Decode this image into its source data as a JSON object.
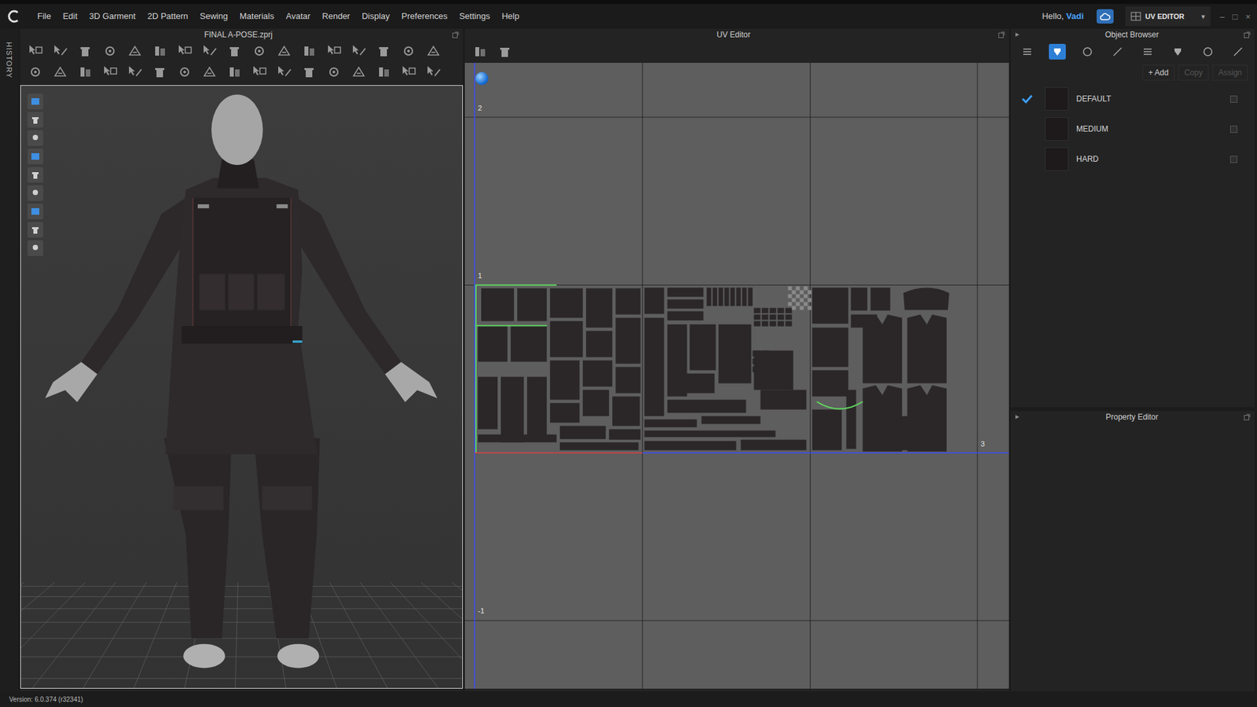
{
  "app": {
    "greeting": "Hello, ",
    "user": "Vadi",
    "mode": "UV EDITOR",
    "mode_arrow": "▾",
    "window_controls": [
      "–",
      "□",
      "×"
    ]
  },
  "menu": [
    "File",
    "Edit",
    "3D Garment",
    "2D Pattern",
    "Sewing",
    "Materials",
    "Avatar",
    "Render",
    "Display",
    "Preferences",
    "Settings",
    "Help"
  ],
  "history_label": "HISTORY",
  "viewport": {
    "title": "FINAL A-POSE.zprj"
  },
  "uv_editor": {
    "title": "UV Editor",
    "axis_labels": [
      {
        "text": "2",
        "kind": "v-top"
      },
      {
        "text": "1",
        "kind": "v-one"
      },
      {
        "text": "-1",
        "kind": "v-neg"
      },
      {
        "text": "3",
        "kind": "u-three"
      }
    ]
  },
  "object_browser": {
    "title": "Object Browser",
    "tabs": [
      {
        "selected": false
      },
      {
        "selected": true
      },
      {
        "selected": false
      },
      {
        "selected": false
      },
      {
        "selected": false
      },
      {
        "selected": false
      },
      {
        "selected": false
      },
      {
        "selected": false
      }
    ],
    "actions": [
      {
        "label": "+ Add",
        "disabled": false
      },
      {
        "label": "Copy",
        "disabled": true
      },
      {
        "label": "Assign",
        "disabled": true
      }
    ],
    "items": [
      {
        "name": "DEFAULT",
        "selected": true
      },
      {
        "name": "MEDIUM",
        "selected": false
      },
      {
        "name": "HARD",
        "selected": false
      }
    ]
  },
  "property_editor": {
    "title": "Property Editor"
  },
  "status_bar": {
    "version": "Version: 6.0.374 (r32341)"
  }
}
